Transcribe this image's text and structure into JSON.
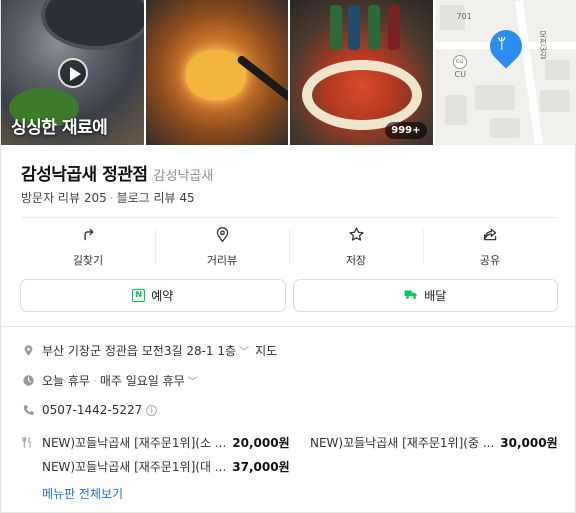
{
  "photos": {
    "overlay_text": "싱싱한 재료에",
    "more_count": "999+",
    "map": {
      "labels": [
        "701",
        "모전3길",
        "CU"
      ]
    }
  },
  "place": {
    "name": "감성낙곱새 정관점",
    "category": "감성낙곱새",
    "visitor_reviews_label": "방문자 리뷰",
    "visitor_reviews_count": "205",
    "blog_reviews_label": "블로그 리뷰",
    "blog_reviews_count": "45"
  },
  "actions": [
    {
      "label": "길찾기",
      "icon": "directions-icon"
    },
    {
      "label": "거리뷰",
      "icon": "location-pin-icon"
    },
    {
      "label": "저장",
      "icon": "star-icon"
    },
    {
      "label": "공유",
      "icon": "share-icon"
    }
  ],
  "buttons": {
    "reserve_label": "예약",
    "reserve_icon_text": "N",
    "delivery_label": "배달"
  },
  "info": {
    "address": "부산 기장군 정관읍 모전3길 28-1 1층",
    "map_link": "지도",
    "hours_status": "오늘 휴무",
    "hours_detail": "매주 일요일 휴무",
    "phone": "0507-1442-5227",
    "menu": [
      {
        "name": "NEW)꼬들낙곱새 [재주문1위](소 ...",
        "price": "20,000원"
      },
      {
        "name": "NEW)꼬들낙곱새 [재주문1위](중 ...",
        "price": "30,000원"
      },
      {
        "name": "NEW)꼬들낙곱새 [재주문1위](대 ...",
        "price": "37,000원"
      }
    ],
    "menu_link": "메뉴판 전체보기"
  },
  "colors": {
    "brand_green": "#03c75a",
    "link_blue": "#1f6fd1",
    "pin_blue": "#2b8cf3"
  }
}
